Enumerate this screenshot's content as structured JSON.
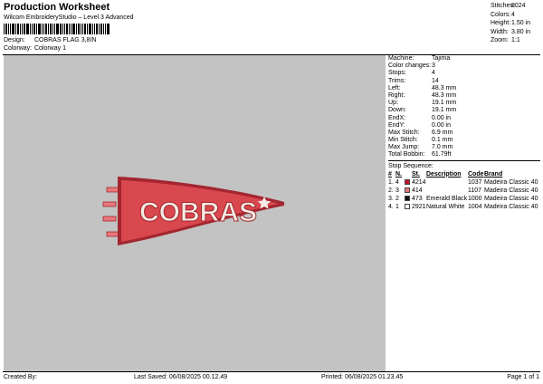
{
  "header": {
    "title": "Production Worksheet",
    "subtitle": "Wilcom EmbroideryStudio – Level 3 Advanced",
    "design_label": "Design:",
    "design_value": "COBRAS FLAG 3,8IN",
    "colorway_label": "Colorway:",
    "colorway_value": "Colorway 1"
  },
  "summary": [
    {
      "label": "Stitches:",
      "value": "8024"
    },
    {
      "label": "Colors:",
      "value": "4"
    },
    {
      "label": "Height:",
      "value": "1.50 in"
    },
    {
      "label": "Width:",
      "value": "3.80 in"
    },
    {
      "label": "Zoom:",
      "value": "1:1"
    }
  ],
  "design": {
    "text": "COBRAS",
    "fill_color": "#d9474f",
    "outline_color": "#a3262f",
    "letter_color": "#f3ece4"
  },
  "details": [
    {
      "label": "Machine:",
      "value": "Tajima"
    },
    {
      "label": "Color changes:",
      "value": "3"
    },
    {
      "label": "Stops:",
      "value": "4"
    },
    {
      "label": "Trims:",
      "value": "14"
    },
    {
      "label": "Left:",
      "value": "48.3 mm"
    },
    {
      "label": "Right:",
      "value": "48.3 mm"
    },
    {
      "label": "Up:",
      "value": "19.1 mm"
    },
    {
      "label": "Down:",
      "value": "19.1 mm"
    },
    {
      "label": "EndX:",
      "value": "0.00 in"
    },
    {
      "label": "EndY:",
      "value": "0.00 in"
    },
    {
      "label": "Max Stitch:",
      "value": "6.9 mm"
    },
    {
      "label": "Min Stitch:",
      "value": "0.1 mm"
    },
    {
      "label": "Max Jump:",
      "value": "7.0 mm"
    },
    {
      "label": "Total Bobbin:",
      "value": "61.79ft"
    }
  ],
  "stop_sequence": {
    "title": "Stop Sequence:",
    "headers": {
      "num": "#",
      "n": "N.",
      "st": "St.",
      "desc": "Description",
      "code": "Code",
      "brand": "Brand"
    },
    "rows": [
      {
        "num": "1.",
        "n": "4",
        "color": "#c8102e",
        "st": "4214",
        "desc": "",
        "code": "1037",
        "brand": "Madeira Classic 40"
      },
      {
        "num": "2.",
        "n": "3",
        "color": "#e8787c",
        "st": "414",
        "desc": "",
        "code": "1107",
        "brand": "Madeira Classic 40"
      },
      {
        "num": "3.",
        "n": "2",
        "color": "#111111",
        "st": "473",
        "desc": "Emerald Black",
        "code": "1000",
        "brand": "Madeira Classic 40"
      },
      {
        "num": "4.",
        "n": "1",
        "color": "#f8f8f2",
        "st": "2921",
        "desc": "Natural White",
        "code": "1004",
        "brand": "Madeira Classic 40"
      }
    ]
  },
  "footer": {
    "created_by": "Created By:",
    "last_saved": "Last Saved: 06/08/2025 00.12.49",
    "printed": "Printed: 06/08/2025 01.23.45",
    "page": "Page 1 of 1"
  }
}
